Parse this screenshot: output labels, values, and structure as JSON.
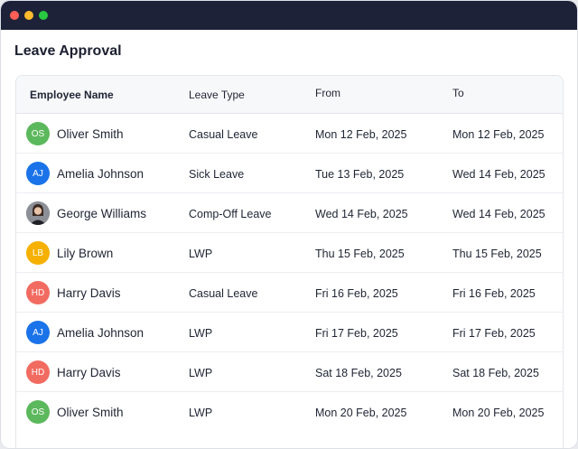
{
  "page": {
    "title": "Leave Approval"
  },
  "table": {
    "headers": [
      "Employee Name",
      "Leave Type",
      "From",
      "To"
    ],
    "rows": [
      {
        "initials": "OS",
        "color": "#5cb85c",
        "name": "Oliver Smith",
        "type": "Casual Leave",
        "from": "Mon 12 Feb, 2025",
        "to": "Mon 12 Feb, 2025"
      },
      {
        "initials": "AJ",
        "color": "#1a73e8",
        "name": "Amelia Johnson",
        "type": "Sick Leave",
        "from": "Tue 13 Feb, 2025",
        "to": "Wed 14 Feb, 2025"
      },
      {
        "initials": "",
        "color": "#7a7f8a",
        "name": "George Williams",
        "type": "Comp-Off Leave",
        "from": "Wed 14 Feb, 2025",
        "to": "Wed 14 Feb, 2025",
        "photo": true
      },
      {
        "initials": "LB",
        "color": "#f5b000",
        "name": "Lily Brown",
        "type": "LWP",
        "from": "Thu 15 Feb, 2025",
        "to": "Thu 15 Feb, 2025"
      },
      {
        "initials": "HD",
        "color": "#f26b61",
        "name": "Harry Davis",
        "type": "Casual Leave",
        "from": "Fri 16 Feb, 2025",
        "to": "Fri 16 Feb, 2025"
      },
      {
        "initials": "AJ",
        "color": "#1a73e8",
        "name": "Amelia Johnson",
        "type": "LWP",
        "from": "Fri 17 Feb, 2025",
        "to": "Fri 17 Feb, 2025"
      },
      {
        "initials": "HD",
        "color": "#f26b61",
        "name": "Harry Davis",
        "type": "LWP",
        "from": "Sat 18 Feb, 2025",
        "to": "Sat 18 Feb, 2025"
      },
      {
        "initials": "OS",
        "color": "#5cb85c",
        "name": "Oliver Smith",
        "type": "LWP",
        "from": "Mon 20 Feb, 2025",
        "to": "Mon 20 Feb, 2025"
      }
    ]
  }
}
